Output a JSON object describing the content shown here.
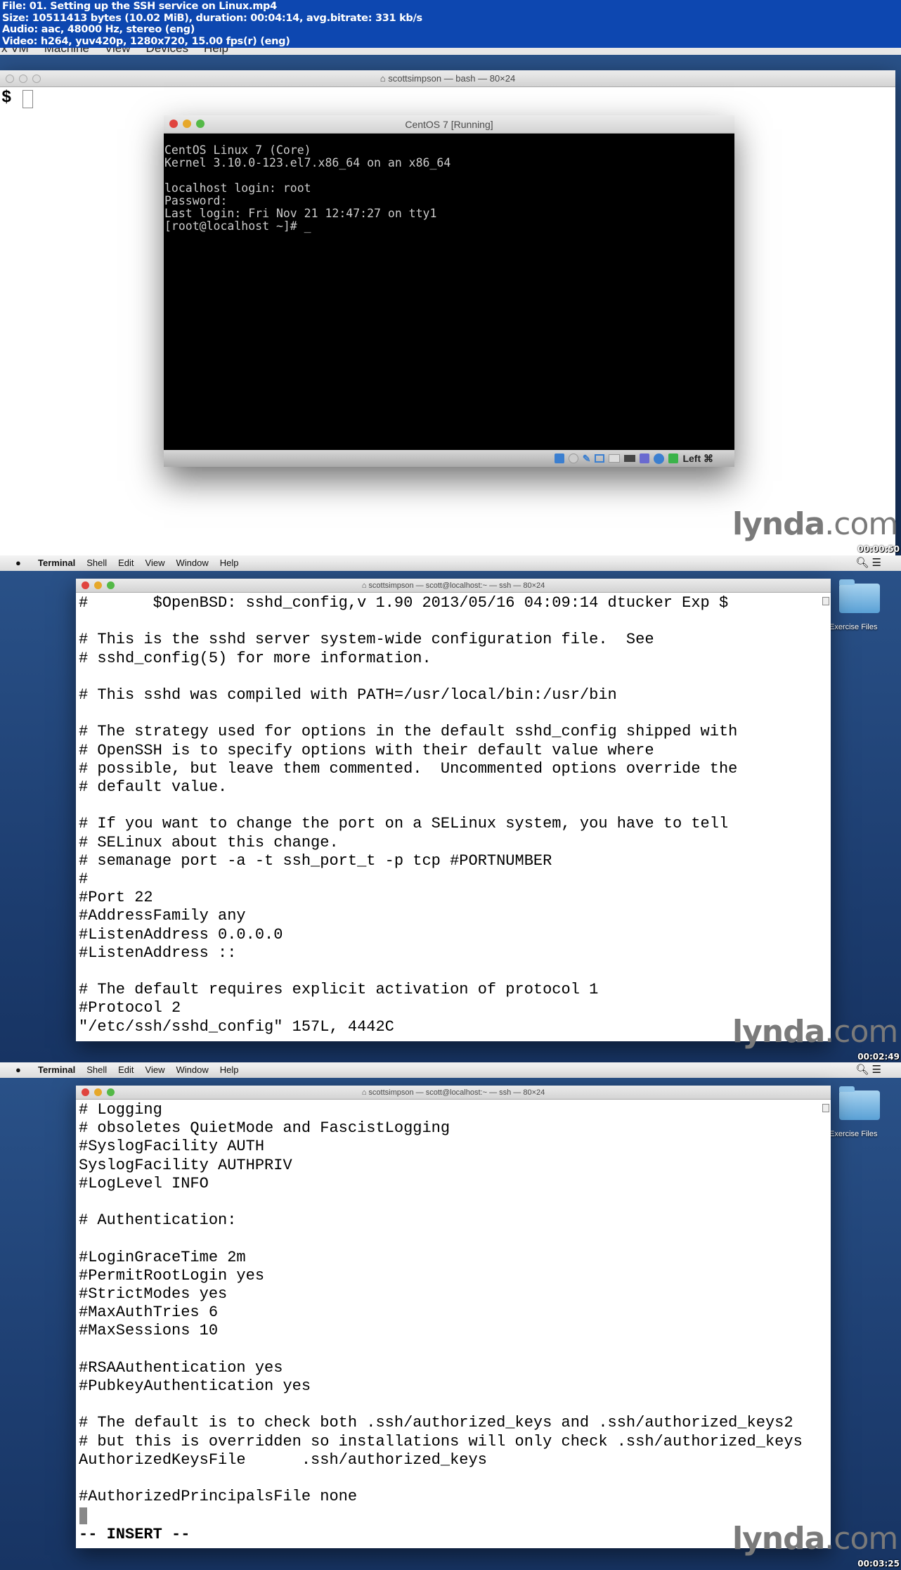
{
  "file_info": {
    "line1": "File: 01. Setting up the SSH service on Linux.mp4",
    "line2": "Size: 10511413 bytes (10.02 MiB), duration: 00:04:14, avg.bitrate: 331 kb/s",
    "line3": "Audio: aac, 48000 Hz, stereo (eng)",
    "line4": "Video: h264, yuv420p, 1280x720, 15.00 fps(r) (eng)"
  },
  "frame1": {
    "vbox_menu": [
      "x VM",
      "Machine",
      "View",
      "Devices",
      "Help"
    ],
    "terminal_title": "scottsimpson — bash — 80×24",
    "prompt": "$",
    "vm": {
      "title": "CentOS 7 [Running]",
      "console": "CentOS Linux 7 (Core)\nKernel 3.10.0-123.el7.x86_64 on an x86_64\n\nlocalhost login: root\nPassword:\nLast login: Fri Nov 21 12:47:27 on tty1\n[root@localhost ~]# _",
      "status_icons": [
        "hard-disk-icon",
        "optical-disc-icon",
        "usb-icon",
        "network-icon",
        "shared-folder-icon",
        "video-capture-icon",
        "vrde-icon",
        "mouse-integration-icon",
        "host-key-icon"
      ],
      "host_key": "Left ⌘"
    },
    "logo": {
      "name": "lynda",
      ".com": ".com"
    },
    "timestamp": "00:00:50"
  },
  "menubar": {
    "app": "Terminal",
    "items": [
      "Shell",
      "Edit",
      "View",
      "Window",
      "Help"
    ]
  },
  "desktop": {
    "folder_label": "Exercise Files"
  },
  "frame2": {
    "terminal_title": "scottsimpson — scott@localhost:~ — ssh — 80×24",
    "content": "#       $OpenBSD: sshd_config,v 1.90 2013/05/16 04:09:14 dtucker Exp $\n\n# This is the sshd server system-wide configuration file.  See\n# sshd_config(5) for more information.\n\n# This sshd was compiled with PATH=/usr/local/bin:/usr/bin\n\n# The strategy used for options in the default sshd_config shipped with\n# OpenSSH is to specify options with their default value where\n# possible, but leave them commented.  Uncommented options override the\n# default value.\n\n# If you want to change the port on a SELinux system, you have to tell\n# SELinux about this change.\n# semanage port -a -t ssh_port_t -p tcp #PORTNUMBER\n#\n#Port 22\n#AddressFamily any\n#ListenAddress 0.0.0.0\n#ListenAddress ::\n\n# The default requires explicit activation of protocol 1\n#Protocol 2\n\"/etc/ssh/sshd_config\" 157L, 4442C",
    "timestamp": "00:02:49"
  },
  "frame3": {
    "terminal_title": "scottsimpson — scott@localhost:~ — ssh — 80×24",
    "content": "# Logging\n# obsoletes QuietMode and FascistLogging\n#SyslogFacility AUTH\nSyslogFacility AUTHPRIV\n#LogLevel INFO\n\n# Authentication:\n\n#LoginGraceTime 2m\n#PermitRootLogin yes\n#StrictModes yes\n#MaxAuthTries 6\n#MaxSessions 10\n\n#RSAAuthentication yes\n#PubkeyAuthentication yes\n\n# The default is to check both .ssh/authorized_keys and .ssh/authorized_keys2\n# but this is overridden so installations will only check .ssh/authorized_keys\nAuthorizedKeysFile      .ssh/authorized_keys\n\n#AuthorizedPrincipalsFile none",
    "mode": "-- INSERT --",
    "timestamp": "00:03:25"
  }
}
